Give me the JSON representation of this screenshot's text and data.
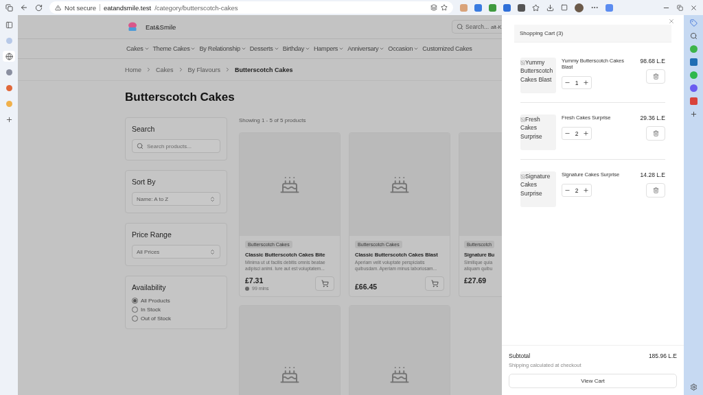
{
  "browser": {
    "security_label": "Not secure",
    "url_host": "eatandsmile.test",
    "url_path": "/category/butterscotch-cakes"
  },
  "site": {
    "brand": "Eat&Smile",
    "search": {
      "placeholder": "Search...",
      "shortcut": "alt-K"
    }
  },
  "nav": [
    {
      "label": "Cakes",
      "dropdown": true
    },
    {
      "label": "Theme Cakes",
      "dropdown": true
    },
    {
      "label": "By Relationship",
      "dropdown": true
    },
    {
      "label": "Desserts",
      "dropdown": true
    },
    {
      "label": "Birthday",
      "dropdown": true
    },
    {
      "label": "Hampers",
      "dropdown": true
    },
    {
      "label": "Anniversary",
      "dropdown": true
    },
    {
      "label": "Occasion",
      "dropdown": true
    },
    {
      "label": "Customized Cakes",
      "dropdown": false
    }
  ],
  "breadcrumb": [
    {
      "label": "Home",
      "current": false
    },
    {
      "label": "Cakes",
      "current": false
    },
    {
      "label": "By Flavours",
      "current": false
    },
    {
      "label": "Butterscotch Cakes",
      "current": true
    }
  ],
  "page_title": "Butterscotch Cakes",
  "filters": {
    "search": {
      "title": "Search",
      "placeholder": "Search products..."
    },
    "sort": {
      "title": "Sort By",
      "value": "Name: A to Z"
    },
    "price": {
      "title": "Price Range",
      "value": "All Prices"
    },
    "availability": {
      "title": "Availability",
      "options": [
        {
          "label": "All Products",
          "selected": true
        },
        {
          "label": "In Stock",
          "selected": false
        },
        {
          "label": "Out of Stock",
          "selected": false
        }
      ]
    }
  },
  "results_count": "Showing 1 - 5 of 5 products",
  "products": [
    {
      "kind": "full",
      "category": "Butterscotch Cakes",
      "name": "Classic Butterscotch Cakes Bite",
      "description": "Minima ut ut facilis debitis omnis beatae adipisci animi. Iure aut est voluptatem...",
      "price": "£7.31",
      "prep_time": "99 mins"
    },
    {
      "kind": "full",
      "category": "Butterscotch Cakes",
      "name": "Classic Butterscotch Cakes Blast",
      "description": "Aperiam velit voluptate perspiciatis quibusdam. Aperiam minus laboriosam...",
      "price": "£66.45"
    },
    {
      "kind": "cut",
      "category": "Butterscotch",
      "name": "Signature Bu",
      "description": "Similique quia\naliquam quibu",
      "price": "£27.69"
    },
    {
      "kind": "image"
    },
    {
      "kind": "image"
    }
  ],
  "cart": {
    "title": "Shopping Cart (3)",
    "items": [
      {
        "image_alt": "Yummy Butterscotch Cakes Blast",
        "name": "Yummy Butterscotch Cakes Blast",
        "quantity": "1",
        "price": "98.68 L.E"
      },
      {
        "image_alt": "Fresh Cakes Surprise",
        "name": "Fresh Cakes Surprise",
        "quantity": "2",
        "price": "29.36 L.E"
      },
      {
        "image_alt": "Signature Cakes Surprise",
        "name": "Signature Cakes Surprise",
        "quantity": "2",
        "price": "14.28 L.E"
      }
    ],
    "subtotal_label": "Subtotal",
    "subtotal": "185.96 L.E",
    "shipping_note": "Shipping calculated at checkout",
    "view_cart": "View Cart"
  }
}
